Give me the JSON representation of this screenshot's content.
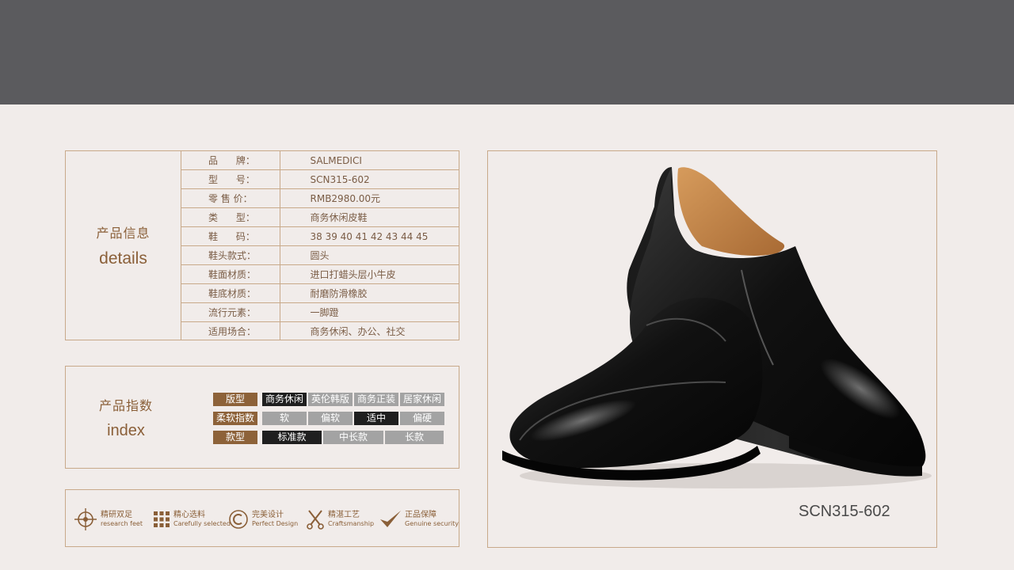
{
  "details": {
    "title_cn": "产品信息",
    "title_en": "details",
    "rows": [
      {
        "label": "品      牌：",
        "value": "SALMEDICI"
      },
      {
        "label": "型      号：",
        "value": "SCN315-602"
      },
      {
        "label": "零 售 价：",
        "value": "RMB2980.00元"
      },
      {
        "label": "类      型：",
        "value": "商务休闲皮鞋"
      },
      {
        "label": "鞋      码：",
        "value": "38 39 40 41 42 43 44 45"
      },
      {
        "label": "鞋头款式：",
        "value": "圆头"
      },
      {
        "label": "鞋面材质：",
        "value": "进口打蜡头层小牛皮"
      },
      {
        "label": "鞋底材质：",
        "value": "耐磨防滑橡胶"
      },
      {
        "label": "流行元素：",
        "value": "一脚蹬"
      },
      {
        "label": "适用场合：",
        "value": "商务休闲、办公、社交"
      }
    ]
  },
  "index": {
    "title_cn": "产品指数",
    "title_en": "index",
    "rows": [
      {
        "label": "版型",
        "options": [
          "商务休闲",
          "英伦韩版",
          "商务正装",
          "居家休闲"
        ],
        "selected": 0
      },
      {
        "label": "柔软指数",
        "options": [
          "软",
          "偏软",
          "适中",
          "偏硬"
        ],
        "selected": 2
      },
      {
        "label": "款型",
        "options": [
          "标准款",
          "中长款",
          "长款"
        ],
        "selected": 0
      }
    ]
  },
  "features": [
    {
      "icon": "crosshair-icon",
      "cn": "精研双足",
      "en": "research feet"
    },
    {
      "icon": "grid-dots-icon",
      "cn": "精心选料",
      "en": "Carefully selected"
    },
    {
      "icon": "circle-c-icon",
      "cn": "完美设计",
      "en": "Perfect Design"
    },
    {
      "icon": "scissors-icon",
      "cn": "精湛工艺",
      "en": "Craftsmanship"
    },
    {
      "icon": "checkmark-icon",
      "cn": "正品保障",
      "en": "Genuine security"
    }
  ],
  "product": {
    "model_caption": "SCN315-602",
    "image": "black-leather-loafer-pair"
  },
  "colors": {
    "band": "#5b5b5e",
    "background": "#f1ecea",
    "accent_brown": "#8d6239",
    "border": "#c8a98a",
    "chip_grey": "#a3a3a3",
    "chip_selected": "#1f1f1f"
  }
}
